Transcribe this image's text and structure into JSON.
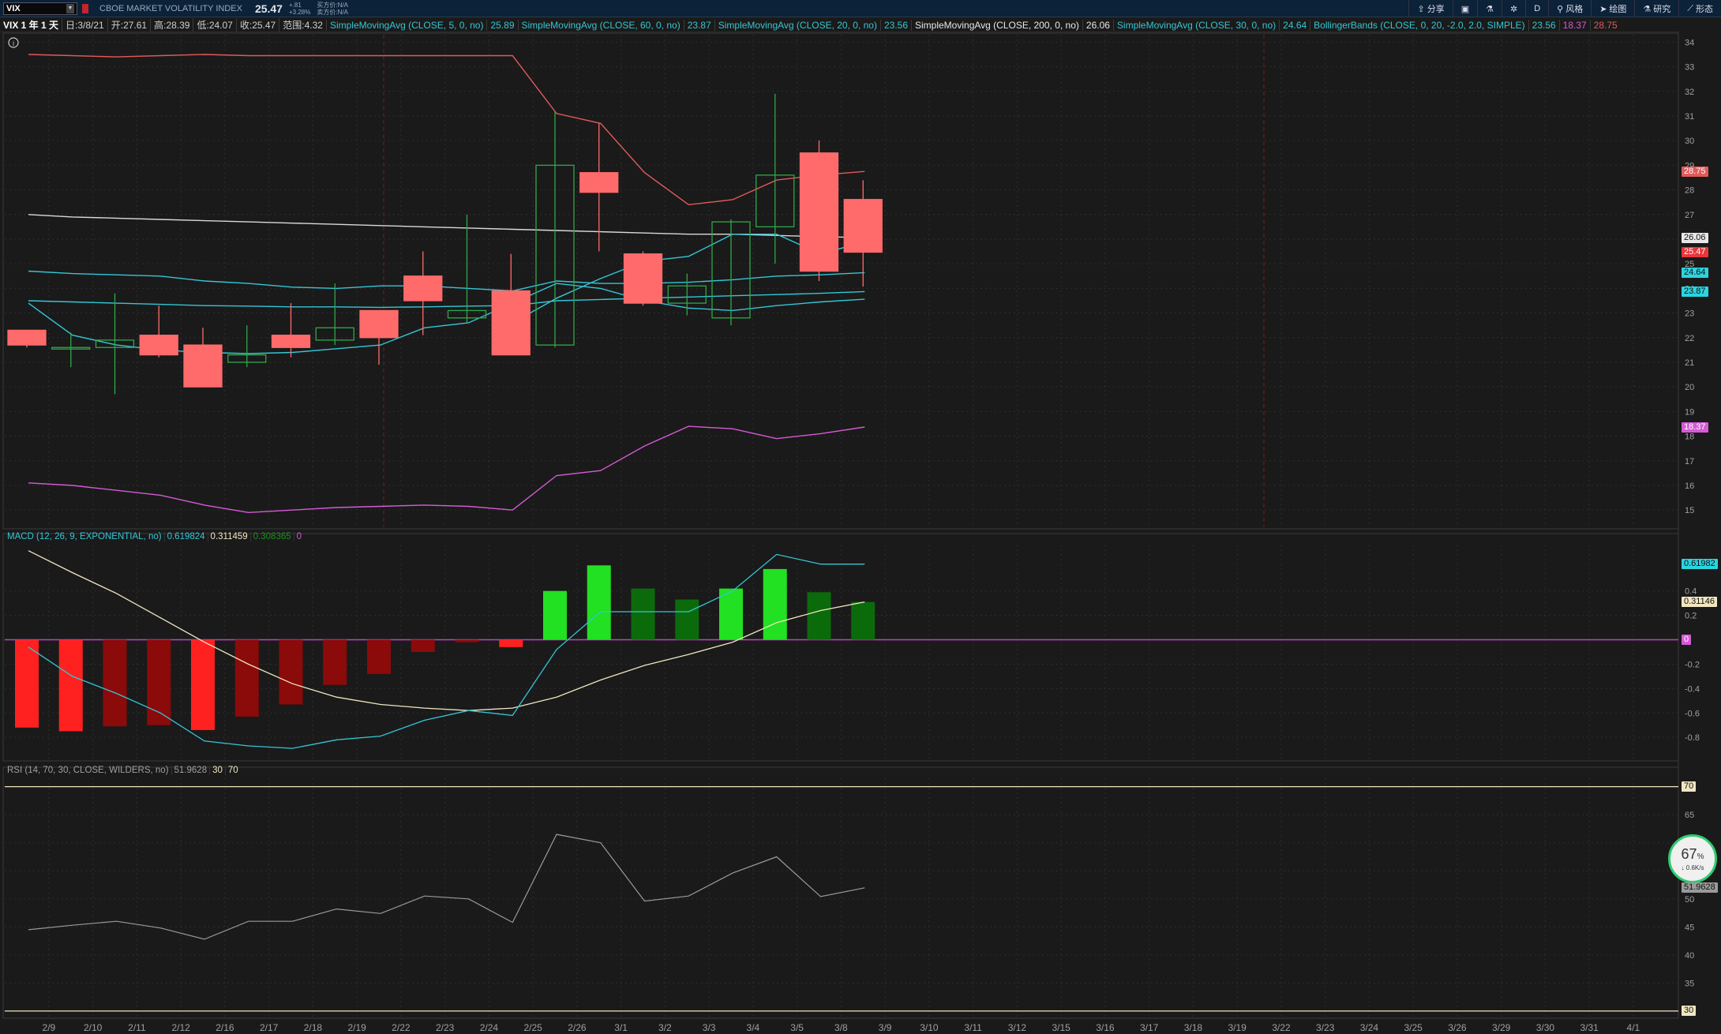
{
  "toolbar": {
    "symbol": "VIX",
    "instrument_name": "CBOE MARKET VOLATILITY INDEX",
    "last_price": "25.47",
    "change": "+.81",
    "change_pct": "+3.28%",
    "bid": "买方价:N/A",
    "ask": "卖方价:N/A",
    "share_label": "分享",
    "interval_label": "D",
    "style_label": "风格",
    "draw_label": "绘图",
    "study_label": "研究",
    "pattern_label": "形态"
  },
  "infobar": {
    "period": "VIX 1 年 1 天",
    "date": "日:3/8/21",
    "open": "开:27.61",
    "high": "高:28.39",
    "low": "低:24.07",
    "close": "收:25.47",
    "range": "范围:4.32",
    "studies": [
      {
        "label": "SimpleMovingAvg (CLOSE, 5, 0, no)",
        "value": "25.89",
        "color": "#34c6d6"
      },
      {
        "label": "SimpleMovingAvg (CLOSE, 60, 0, no)",
        "value": "23.87",
        "color": "#34c6d6"
      },
      {
        "label": "SimpleMovingAvg (CLOSE, 20, 0, no)",
        "value": "23.56",
        "color": "#34c6d6"
      },
      {
        "label": "SimpleMovingAvg (CLOSE, 200, 0, no)",
        "value": "26.06",
        "color": "#e8e8e8"
      },
      {
        "label": "SimpleMovingAvg (CLOSE, 30, 0, no)",
        "value": "24.64",
        "color": "#34c6d6"
      }
    ],
    "bollinger": {
      "label": "BollingerBands (CLOSE, 0, 20, -2.0, 2.0, SIMPLE)",
      "lower": "23.56",
      "mid": "18.37",
      "upper": "28.75"
    }
  },
  "macd": {
    "label": "MACD (12, 26, 9, EXPONENTIAL, no)",
    "value": "0.619824",
    "avg": "0.311459",
    "diff": "0.308365",
    "zero": "0"
  },
  "rsi": {
    "label": "RSI (14, 70, 30, CLOSE, WILDERS, no)",
    "value": "51.9628",
    "low": "30",
    "high": "70"
  },
  "price_tags": [
    {
      "text": "28.75",
      "price": 28.75,
      "bg": "#e05a5a",
      "fg": "#fff"
    },
    {
      "text": "26.06",
      "price": 26.06,
      "bg": "#e8e8e8",
      "fg": "#111"
    },
    {
      "text": "25.47",
      "price": 25.47,
      "bg": "#e8363b",
      "fg": "#fff"
    },
    {
      "text": "24.64",
      "price": 24.64,
      "bg": "#2bd4e0",
      "fg": "#111"
    },
    {
      "text": "23.87",
      "price": 23.87,
      "bg": "#2bd4e0",
      "fg": "#111"
    },
    {
      "text": "18.37",
      "price": 18.37,
      "bg": "#d65ad6",
      "fg": "#fff"
    }
  ],
  "macd_tags": [
    {
      "text": "0.61982",
      "value": 0.61982,
      "bg": "#2bd4e0",
      "fg": "#111"
    },
    {
      "text": "0.31146",
      "value": 0.31146,
      "bg": "#f0e6c0",
      "fg": "#111"
    },
    {
      "text": "0",
      "value": 0,
      "bg": "#d65ad6",
      "fg": "#fff"
    }
  ],
  "rsi_tags": [
    {
      "text": "70",
      "value": 70,
      "bg": "#f0e6c0",
      "fg": "#111"
    },
    {
      "text": "51.9628",
      "value": 51.9628,
      "bg": "#9a9a9a",
      "fg": "#111"
    },
    {
      "text": "30",
      "value": 30,
      "bg": "#f0e6c0",
      "fg": "#111"
    }
  ],
  "gauge": {
    "percent": "67",
    "unit": "%",
    "rate": "↓ 0.6K/s"
  },
  "colors": {
    "up": "#2fa84a",
    "down": "#ff6b6b",
    "bg": "#1a1a1a",
    "grid": "#2e2e2e"
  },
  "chart_data": {
    "type": "candlestick",
    "price_axis": {
      "ticks": [
        15,
        16,
        17,
        18,
        19,
        20,
        21,
        22,
        23,
        24,
        25,
        26,
        27,
        28,
        29,
        30,
        31,
        32,
        33,
        34
      ],
      "range": [
        14.3,
        34.3
      ]
    },
    "x_ticks": [
      "2/9",
      "2/10",
      "2/11",
      "2/12",
      "2/16",
      "2/17",
      "2/18",
      "2/19",
      "2/22",
      "2/23",
      "2/24",
      "2/25",
      "2/26",
      "3/1",
      "3/2",
      "3/3",
      "3/4",
      "3/5",
      "3/8",
      "3/9",
      "3/10",
      "3/11",
      "3/12",
      "3/15",
      "3/16",
      "3/17",
      "3/18",
      "3/19",
      "3/22",
      "3/23",
      "3/24",
      "3/25",
      "3/26",
      "3/29",
      "3/30",
      "3/31",
      "4/1"
    ],
    "candles": [
      {
        "date": "2/8",
        "o": 22.3,
        "h": 22.3,
        "l": 21.6,
        "c": 21.7
      },
      {
        "date": "2/9",
        "o": 21.6,
        "h": 22.2,
        "l": 20.8,
        "c": 21.6
      },
      {
        "date": "2/10",
        "o": 21.6,
        "h": 23.8,
        "l": 19.7,
        "c": 21.9
      },
      {
        "date": "2/11",
        "o": 22.1,
        "h": 23.3,
        "l": 21.2,
        "c": 21.3
      },
      {
        "date": "2/12",
        "o": 21.7,
        "h": 22.4,
        "l": 20.0,
        "c": 20.0
      },
      {
        "date": "2/16",
        "o": 21.0,
        "h": 22.5,
        "l": 20.8,
        "c": 21.3
      },
      {
        "date": "2/17",
        "o": 22.1,
        "h": 23.4,
        "l": 21.2,
        "c": 21.6
      },
      {
        "date": "2/18",
        "o": 21.9,
        "h": 24.2,
        "l": 21.7,
        "c": 22.4
      },
      {
        "date": "2/19",
        "o": 23.1,
        "h": 23.1,
        "l": 20.9,
        "c": 22.0
      },
      {
        "date": "2/22",
        "o": 24.5,
        "h": 25.5,
        "l": 22.1,
        "c": 23.5
      },
      {
        "date": "2/23",
        "o": 22.8,
        "h": 27.0,
        "l": 22.6,
        "c": 23.1
      },
      {
        "date": "2/24",
        "o": 23.9,
        "h": 25.4,
        "l": 21.3,
        "c": 21.3
      },
      {
        "date": "2/25",
        "o": 21.7,
        "h": 31.2,
        "l": 21.6,
        "c": 29.0
      },
      {
        "date": "2/26",
        "o": 28.7,
        "h": 30.7,
        "l": 25.5,
        "c": 27.9
      },
      {
        "date": "3/1",
        "o": 25.4,
        "h": 25.5,
        "l": 23.3,
        "c": 23.4
      },
      {
        "date": "3/2",
        "o": 23.4,
        "h": 24.6,
        "l": 22.9,
        "c": 24.1
      },
      {
        "date": "3/3",
        "o": 22.8,
        "h": 26.8,
        "l": 22.5,
        "c": 26.7
      },
      {
        "date": "3/4",
        "o": 26.5,
        "h": 31.9,
        "l": 25.0,
        "c": 28.6
      },
      {
        "date": "3/5",
        "o": 29.5,
        "h": 30.0,
        "l": 24.3,
        "c": 24.7
      },
      {
        "date": "3/8",
        "o": 27.61,
        "h": 28.39,
        "l": 24.07,
        "c": 25.47
      }
    ],
    "series": [
      {
        "name": "SimpleMovingAvg (CLOSE, 200, 0, no)",
        "color": "#d9d9d9",
        "values": [
          27.0,
          26.9,
          26.85,
          26.8,
          26.75,
          26.7,
          26.65,
          26.6,
          26.55,
          26.5,
          26.45,
          26.4,
          26.35,
          26.3,
          26.25,
          26.2,
          26.2,
          26.15,
          26.1,
          26.06
        ]
      },
      {
        "name": "SimpleMovingAvg (CLOSE, 30, 0, no)",
        "color": "#34c6d6",
        "values": [
          24.7,
          24.6,
          24.55,
          24.5,
          24.3,
          24.2,
          24.05,
          24.0,
          24.1,
          24.1,
          24.0,
          23.9,
          24.3,
          24.2,
          24.2,
          24.25,
          24.35,
          24.5,
          24.55,
          24.64
        ]
      },
      {
        "name": "SimpleMovingAvg (CLOSE, 60, 0, no)",
        "color": "#34c6d6",
        "values": [
          23.5,
          23.45,
          23.4,
          23.35,
          23.3,
          23.28,
          23.25,
          23.25,
          23.23,
          23.25,
          23.28,
          23.3,
          23.5,
          23.55,
          23.6,
          23.65,
          23.7,
          23.75,
          23.8,
          23.87
        ]
      },
      {
        "name": "SimpleMovingAvg (CLOSE, 20, 0, no)",
        "color": "#34c6d6",
        "values": [
          23.4,
          22.1,
          21.7,
          21.5,
          21.4,
          21.35,
          21.4,
          21.55,
          21.7,
          22.4,
          22.6,
          23.4,
          24.2,
          24.0,
          23.5,
          23.2,
          23.1,
          23.3,
          23.45,
          23.56
        ]
      },
      {
        "name": "SimpleMovingAvg (CLOSE, 5, 0, no)",
        "color": "#34c6d6",
        "values": [
          null,
          null,
          null,
          null,
          null,
          null,
          null,
          null,
          null,
          null,
          null,
          22.6,
          23.6,
          24.4,
          25.1,
          25.3,
          26.2,
          26.2,
          25.4,
          25.89
        ]
      },
      {
        "name": "BollingerBands upper",
        "color": "#e05a5a",
        "values": [
          33.5,
          33.45,
          33.4,
          33.45,
          33.5,
          33.45,
          33.45,
          33.45,
          33.45,
          33.45,
          33.45,
          33.45,
          31.1,
          30.7,
          28.7,
          27.4,
          27.6,
          28.4,
          28.6,
          28.75
        ]
      },
      {
        "name": "BollingerBands lower",
        "color": "#d65ad6",
        "values": [
          16.1,
          16.0,
          15.8,
          15.6,
          15.2,
          14.9,
          15.0,
          15.1,
          15.15,
          15.2,
          15.15,
          15.0,
          16.4,
          16.6,
          17.6,
          18.4,
          18.3,
          17.9,
          18.1,
          18.37
        ]
      }
    ],
    "macd": {
      "axis_ticks": [
        0.4,
        0.2,
        0,
        -0.2,
        -0.4,
        -0.6,
        -0.8
      ],
      "range": [
        -0.98,
        0.78
      ],
      "hist": [
        -0.72,
        -0.75,
        -0.71,
        -0.7,
        -0.74,
        -0.63,
        -0.53,
        -0.37,
        -0.28,
        -0.1,
        -0.02,
        -0.06,
        0.4,
        0.61,
        0.42,
        0.33,
        0.42,
        0.58,
        0.39,
        0.31
      ],
      "hist_colors": [
        "#ff2020",
        "#ff2020",
        "#8b0a0a",
        "#8b0a0a",
        "#ff2020",
        "#8b0a0a",
        "#8b0a0a",
        "#8b0a0a",
        "#8b0a0a",
        "#8b0a0a",
        "#8b0a0a",
        "#ff2020",
        "#22e022",
        "#22e022",
        "#0b6b0b",
        "#0b6b0b",
        "#22e022",
        "#22e022",
        "#0b6b0b",
        "#0b6b0b"
      ],
      "macd": [
        -0.06,
        -0.3,
        -0.44,
        -0.6,
        -0.83,
        -0.87,
        -0.89,
        -0.82,
        -0.79,
        -0.66,
        -0.58,
        -0.62,
        -0.08,
        0.23,
        0.23,
        0.23,
        0.4,
        0.7,
        0.62,
        0.62
      ],
      "signal": [
        0.73,
        0.55,
        0.38,
        0.18,
        -0.02,
        -0.2,
        -0.36,
        -0.47,
        -0.53,
        -0.56,
        -0.58,
        -0.56,
        -0.47,
        -0.33,
        -0.21,
        -0.12,
        -0.02,
        0.14,
        0.24,
        0.31
      ]
    },
    "rsi": {
      "axis_ticks": [
        70,
        65,
        60,
        55,
        50,
        45,
        40,
        35,
        30
      ],
      "range": [
        29.0,
        71.5
      ],
      "values": [
        44.5,
        45.3,
        46.0,
        44.8,
        42.8,
        46.0,
        46.0,
        48.2,
        47.4,
        50.5,
        50.0,
        45.8,
        61.5,
        60.0,
        49.6,
        50.5,
        54.6,
        57.5,
        50.4,
        51.96
      ]
    }
  }
}
